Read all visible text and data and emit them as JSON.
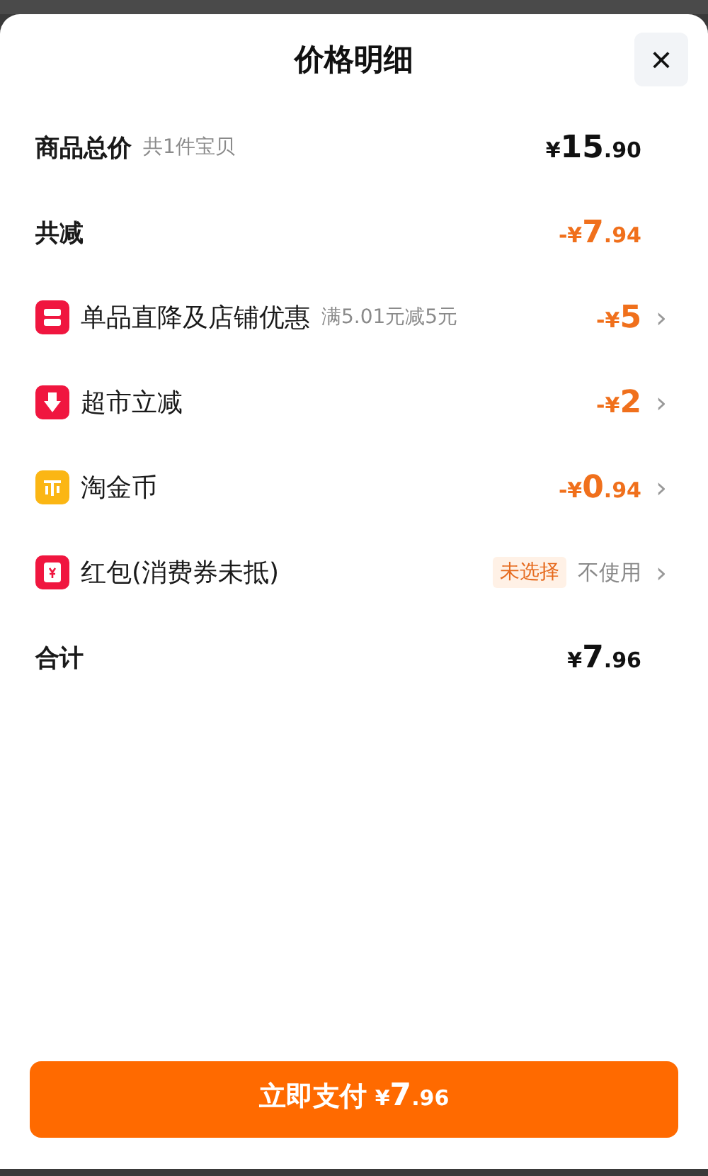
{
  "sheet": {
    "title": "价格明细",
    "close": "×"
  },
  "rows": [
    {
      "kind": "total",
      "label": "商品总价",
      "note": "共1件宝贝",
      "amount": {
        "prefix": "¥",
        "main": "15",
        "fraction": ".90"
      }
    },
    {
      "kind": "reduction",
      "label": "共减",
      "amount": {
        "prefix": "-¥",
        "main": "7",
        "fraction": ".94"
      }
    },
    {
      "kind": "store",
      "label": "单品直降及店铺优惠",
      "note": "满5.01元减5元",
      "amount": {
        "prefix": "-¥",
        "main": "5"
      },
      "chevron": "›"
    },
    {
      "kind": "market",
      "label": "超市立减",
      "amount": {
        "prefix": "-¥",
        "main": "2"
      },
      "chevron": "›"
    },
    {
      "kind": "coin",
      "label": "淘金币",
      "amount": {
        "prefix": "-¥",
        "main": "0",
        "fraction": ".94"
      },
      "chevron": "›"
    },
    {
      "kind": "packet",
      "label": "红包(消费券未抵)",
      "tag": "未选择",
      "status": "不使用",
      "chevron": "›"
    },
    {
      "kind": "sum",
      "label": "合计",
      "amount": {
        "prefix": "¥",
        "main": "7",
        "fraction": ".96"
      }
    }
  ],
  "pay_button": {
    "label": "立即支付",
    "amount": {
      "prefix": "¥",
      "main": "7",
      "fraction": ".96"
    }
  }
}
